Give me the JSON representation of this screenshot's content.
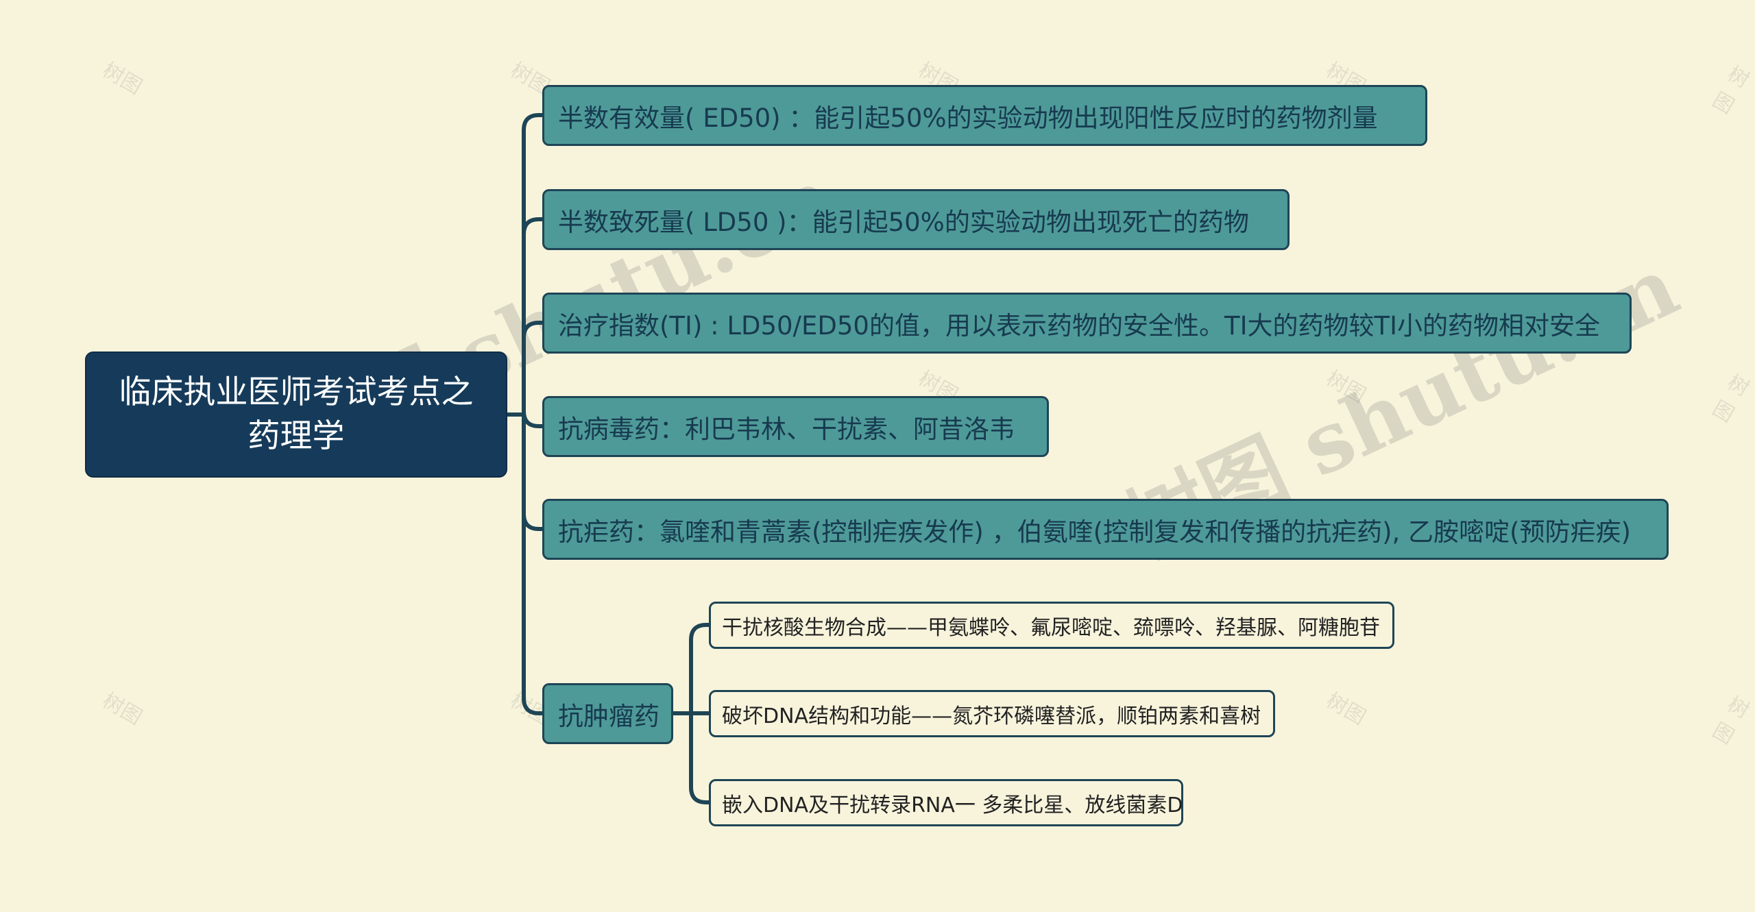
{
  "mindmap": {
    "root": "临床执业医师考试考点之药理学",
    "branches": [
      {
        "label": "半数有效量( ED50) ：能引起50%的实验动物出现阳性反应时的药物剂量"
      },
      {
        "label": "半数致死量( LD50 )：能引起50%的实验动物出现死亡的药物"
      },
      {
        "label": "治疗指数(TI) : LD50/ED50的值，用以表示药物的安全性。TI大的药物较TI小的药物相对安全"
      },
      {
        "label": "抗病毒药：利巴韦林、干扰素、阿昔洛韦"
      },
      {
        "label": "抗疟药：氯喹和青蒿素(控制疟疾发作) ，伯氨喹(控制复发和传播的抗疟药), 乙胺嘧啶(预防疟疾)"
      },
      {
        "label": "抗肿瘤药",
        "children": [
          {
            "label": "干扰核酸生物合成——甲氨蝶呤、氟尿嘧啶、巯嘌呤、羟基脲、阿糖胞苷"
          },
          {
            "label": "破坏DNA结构和功能——氮芥环磷噻替派，顺铂两素和喜树"
          },
          {
            "label": "嵌入DNA及干扰转录RNA一 多柔比星、放线菌素D"
          }
        ]
      }
    ]
  },
  "watermark": {
    "main_left": "树图 shutu.cn",
    "main_right": "树图 shutu.cn",
    "small": "树图"
  },
  "colors": {
    "background": "#f8f4dc",
    "root_fill": "#163b5a",
    "branch_fill": "#4e9a98",
    "leaf_fill": "#f8f4dc",
    "connector": "#1e4556"
  }
}
